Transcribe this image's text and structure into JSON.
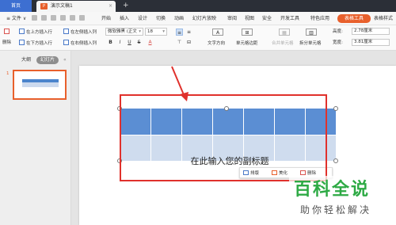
{
  "titlebar": {
    "home_tab": "首页",
    "doc_tab": "演示文稿1",
    "doc_icon": "P",
    "close_glyph": "×",
    "add_tab_glyph": "+"
  },
  "menubar": {
    "file_label": "≡ 文件 ∨",
    "items": [
      "开始",
      "插入",
      "设计",
      "切换",
      "动画",
      "幻灯片放映",
      "审阅",
      "视图",
      "安全",
      "开发工具",
      "特色应用"
    ],
    "active_item": "表格工具",
    "last_item": "表格样式"
  },
  "ribbon": {
    "delete_label": "删除",
    "insert_above": "在上方插入行",
    "insert_below": "在下方插入行",
    "insert_left": "在左侧插入列",
    "insert_right": "在右侧插入列",
    "font_name": "微软雅黑 (正文",
    "font_size": "18",
    "bold": "B",
    "italic": "I",
    "underline": "U",
    "strike": "S",
    "font_color": "A",
    "text_direction": "文字方向",
    "cell_margin": "单元格边距",
    "merge_cells": "合并单元格",
    "split_cells": "拆分单元格",
    "height_label": "高度:",
    "height_value": "2.78厘米",
    "width_label": "宽度:",
    "width_value": "3.81厘米"
  },
  "panel": {
    "tab_outline": "大纲",
    "tab_slides": "幻灯片",
    "toggle_glyph": "«",
    "slide_number": "1"
  },
  "slide": {
    "subtitle": "在此输入您的副标题",
    "mini_toolbar": {
      "layout": "排版",
      "beautify": "美化",
      "delete": "删除"
    }
  },
  "watermark": {
    "logo": "百科全说",
    "tagline": "助你轻松解决"
  },
  "colors": {
    "accent": "#e8602c",
    "table_header": "#5b8ed3",
    "table_body": "#cfdcee",
    "annotation": "#e0312c",
    "watermark_green": "#2eaa45"
  }
}
